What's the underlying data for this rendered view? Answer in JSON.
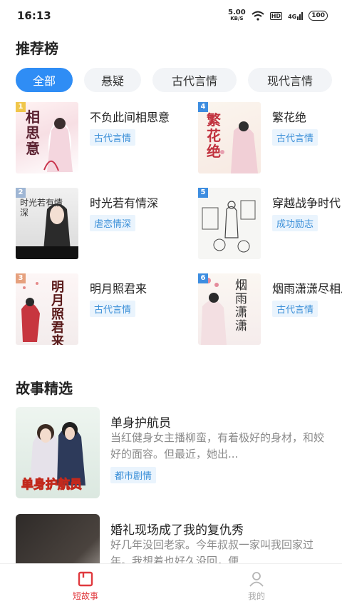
{
  "status": {
    "time": "16:13",
    "speed": "5.00",
    "speed_unit": "KB/S",
    "hd": "HD",
    "net": "4G",
    "battery": "100"
  },
  "ranking": {
    "title": "推荐榜",
    "tabs": [
      "全部",
      "悬疑",
      "古代言情",
      "现代言情"
    ],
    "books": [
      {
        "rank": "1",
        "title": "不负此间相思意",
        "tag": "古代言情",
        "cover_text": "相思意",
        "badge_color": "#f0c64a"
      },
      {
        "rank": "2",
        "title": "时光若有情深",
        "tag": "虐恋情深",
        "cover_text": "时光若有情深",
        "badge_color": "#9fb6d4"
      },
      {
        "rank": "3",
        "title": "明月照君来",
        "tag": "古代言情",
        "cover_text": "明月照君来",
        "badge_color": "#e6a17e"
      },
      {
        "rank": "4",
        "title": "繁花绝",
        "tag": "古代言情",
        "cover_text": "繁花绝",
        "badge_color": "#3d8de0"
      },
      {
        "rank": "5",
        "title": "穿越战争时代",
        "tag": "成功励志",
        "cover_text": "",
        "badge_color": "#3d8de0"
      },
      {
        "rank": "6",
        "title": "烟雨潇潇尽相思",
        "tag": "古代言情",
        "cover_text": "烟雨潇潇",
        "badge_color": "#3d8de0"
      }
    ]
  },
  "stories": {
    "title": "故事精选",
    "items": [
      {
        "title": "单身护航员",
        "desc": "当红健身女主播柳蛮，有着极好的身材，和姣好的面容。但最近，她出...",
        "tag": "都市剧情",
        "cover_text": "单身护航员"
      },
      {
        "title": "婚礼现场成了我的复仇秀",
        "desc": "好几年没回老家。今年叔叔一家叫我回家过年。我想着也好久没回，便...",
        "tag": "",
        "cover_text": ""
      }
    ]
  },
  "nav": {
    "home": "短故事",
    "me": "我的"
  }
}
